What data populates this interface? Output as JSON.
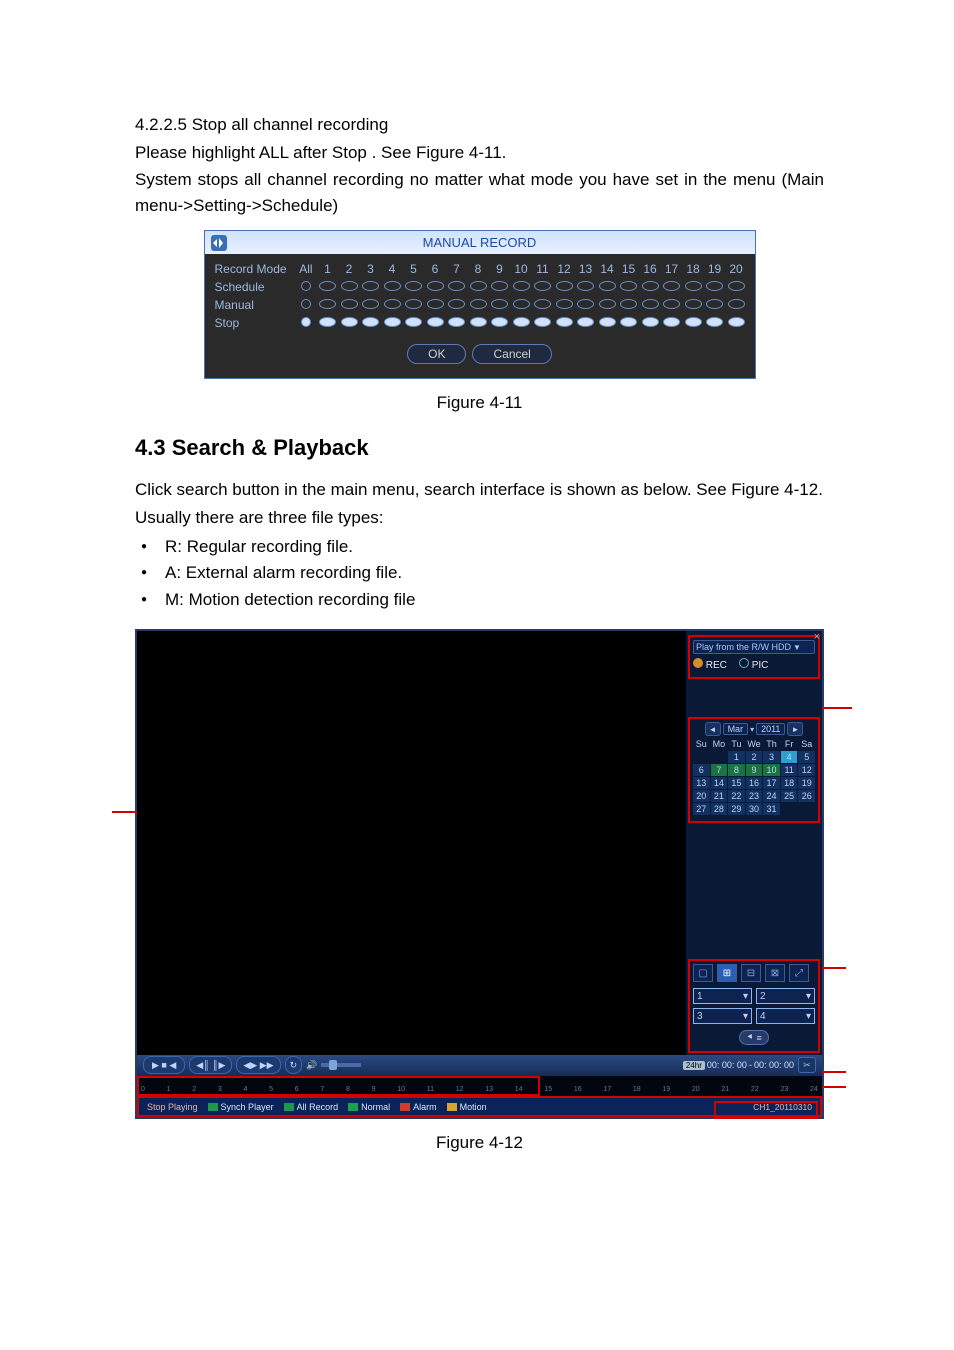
{
  "s4225": {
    "heading": "4.2.2.5  Stop all channel recording",
    "line1": "Please highlight  ALL  after  Stop . See Figure 4-11.",
    "line2": "System stops all channel recording no matter what mode you have set in the menu (Main menu->Setting->Schedule)"
  },
  "fig11_caption": "Figure 4-11",
  "manual_record": {
    "title": "MANUAL RECORD",
    "cols_label": "All",
    "rows": [
      {
        "label": "Record Mode"
      },
      {
        "label": "Schedule"
      },
      {
        "label": "Manual"
      },
      {
        "label": "Stop"
      }
    ],
    "channels": [
      "1",
      "2",
      "3",
      "4",
      "5",
      "6",
      "7",
      "8",
      "9",
      "10",
      "11",
      "12",
      "13",
      "14",
      "15",
      "16",
      "17",
      "18",
      "19",
      "20"
    ],
    "ok": "OK",
    "cancel": "Cancel"
  },
  "s43": {
    "heading": "4.3    Search & Playback",
    "p1": "Click search button in the main menu, search interface is shown as below. See Figure 4-12.",
    "p2": "Usually there are three file types:",
    "bullets": [
      "R: Regular recording file.",
      "A: External alarm recording file.",
      "M: Motion detection recording file"
    ]
  },
  "playback": {
    "hdd_label": "Play from the R/W HDD",
    "rec_label": "REC",
    "pic_label": "PIC",
    "cal": {
      "month": "Mar",
      "year": "2011",
      "dow": [
        "Su",
        "Mo",
        "Tu",
        "We",
        "Th",
        "Fr",
        "Sa"
      ],
      "days": [
        [
          "",
          "",
          "1",
          "2",
          "3",
          "4",
          "5"
        ],
        [
          "6",
          "7",
          "8",
          "9",
          "10",
          "11",
          "12"
        ],
        [
          "13",
          "14",
          "15",
          "16",
          "17",
          "18",
          "19"
        ],
        [
          "20",
          "21",
          "22",
          "23",
          "24",
          "25",
          "26"
        ],
        [
          "27",
          "28",
          "29",
          "30",
          "31",
          "",
          ""
        ]
      ],
      "rec_days": [
        "7",
        "8",
        "9",
        "10"
      ],
      "today": "4"
    },
    "channels": [
      "1",
      "2",
      "3",
      "4"
    ],
    "list_icon_label": "≡",
    "time_start": "00: 00: 00",
    "time_sep": "-",
    "time_end": "00: 00: 00",
    "ruler_hours": [
      "0",
      "1",
      "2",
      "3",
      "4",
      "5",
      "6",
      "7",
      "8",
      "9",
      "10",
      "11",
      "12",
      "13",
      "14",
      "15",
      "16",
      "17",
      "18",
      "19",
      "20",
      "21",
      "22",
      "23",
      "24"
    ],
    "zoom_label": "24hr",
    "legend": {
      "stop": "Stop Playing",
      "synch": "Synch Player",
      "all": "All Record",
      "normal": "Normal",
      "alarm": "Alarm",
      "motion": "Motion",
      "download": "CH1_20110310"
    }
  },
  "fig12_caption": "Figure 4-12"
}
